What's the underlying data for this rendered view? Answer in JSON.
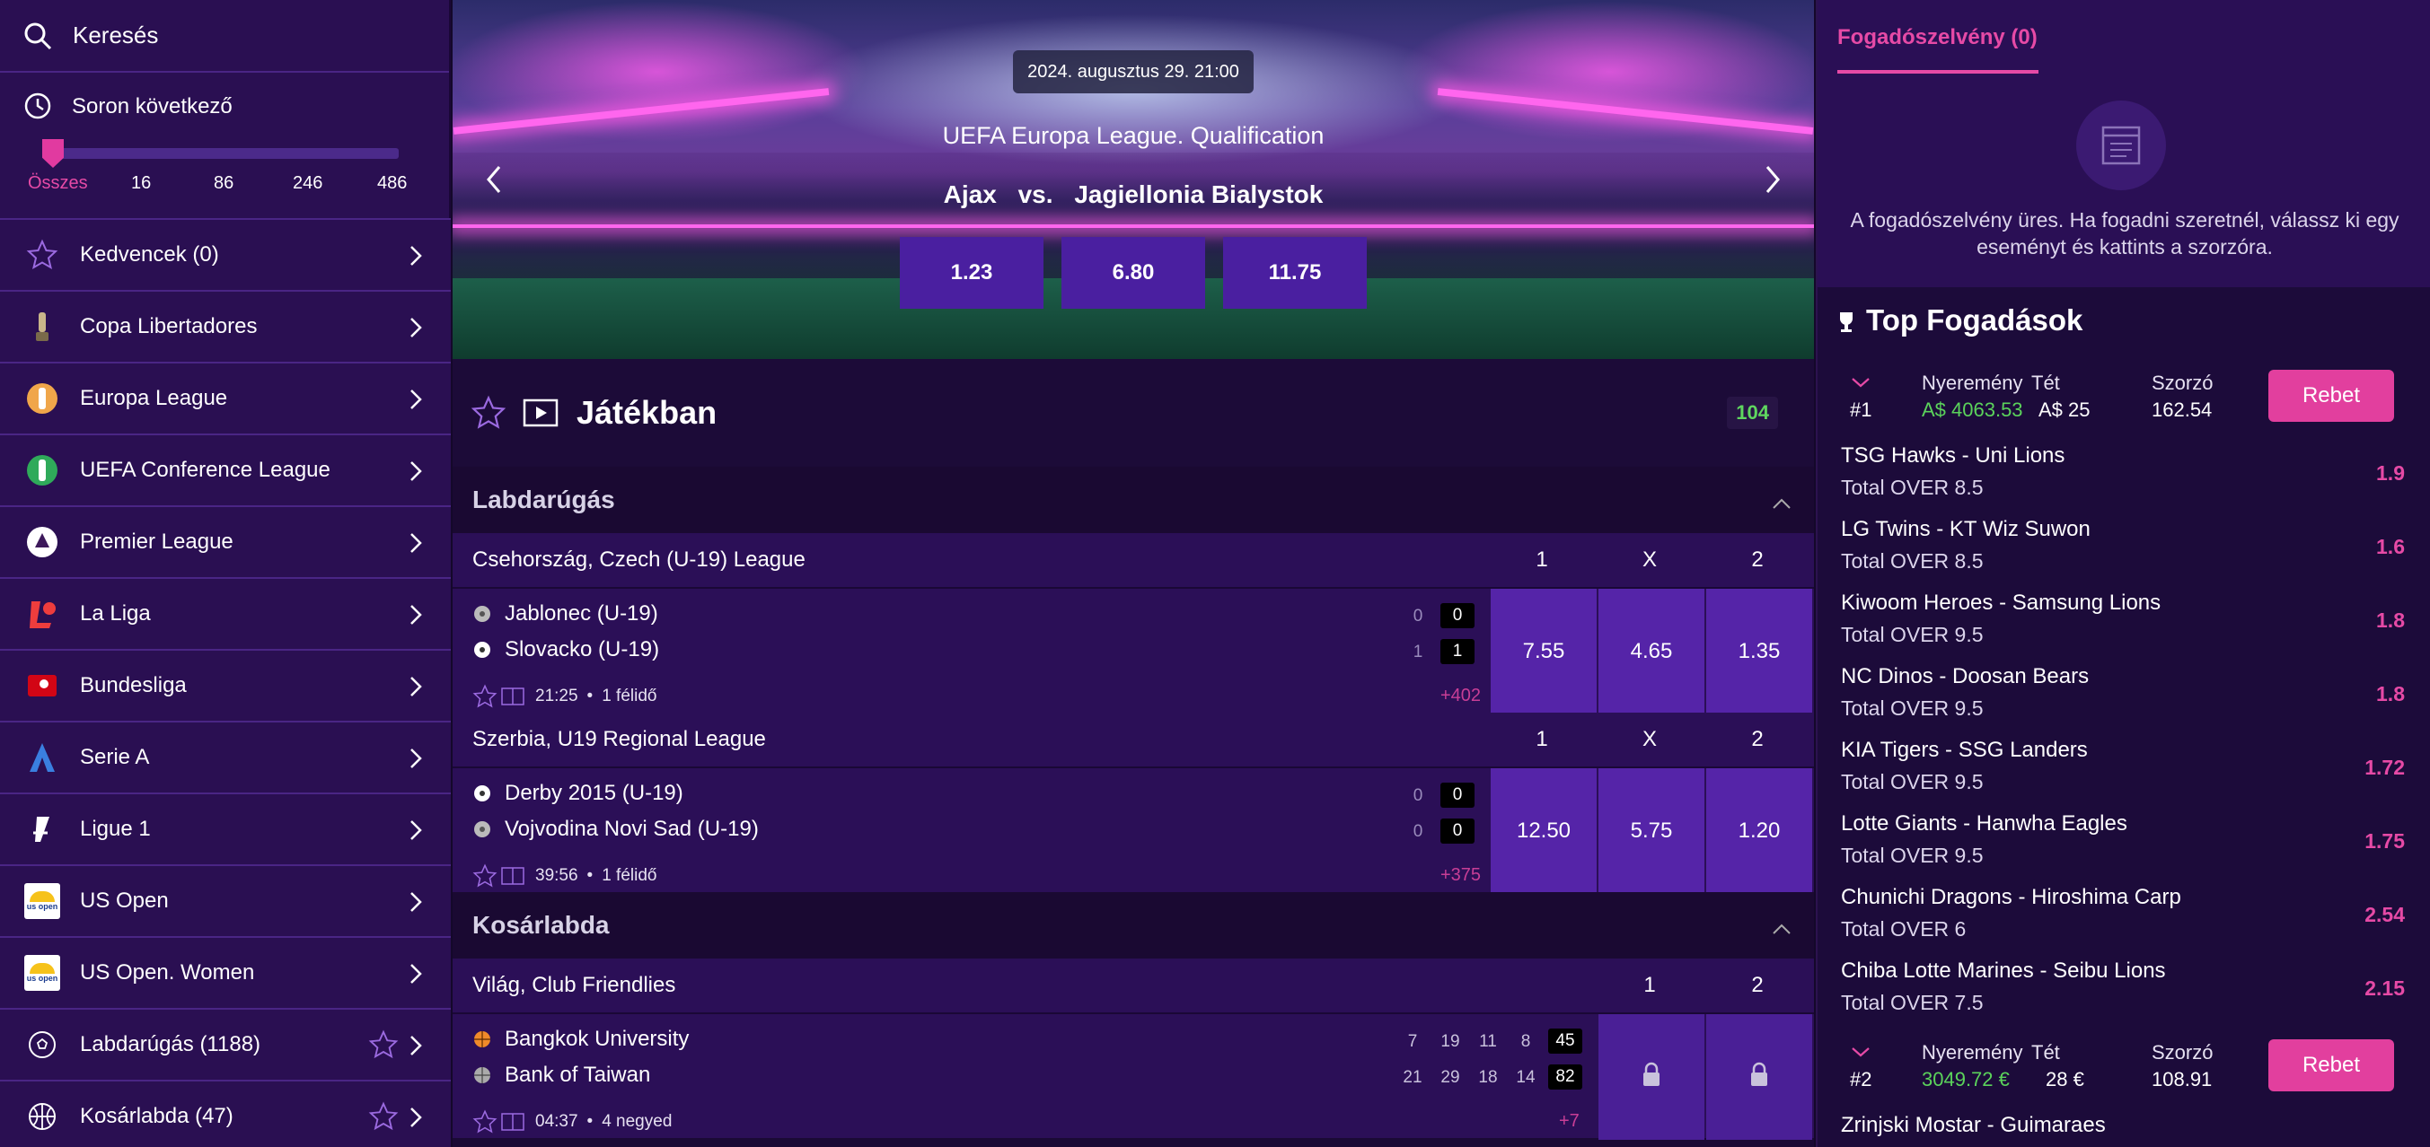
{
  "sidebar": {
    "search_label": "Keresés",
    "next_label": "Soron következő",
    "filter_labels": [
      "Összes",
      "16",
      "86",
      "246",
      "486"
    ],
    "items": [
      {
        "label": "Kedvencek (0)",
        "icon": "star-icon"
      },
      {
        "label": "Copa Libertadores",
        "icon": "copa-libertadores-logo"
      },
      {
        "label": "Europa League",
        "icon": "europa-league-logo"
      },
      {
        "label": "UEFA Conference League",
        "icon": "conference-league-logo"
      },
      {
        "label": "Premier League",
        "icon": "premier-league-logo"
      },
      {
        "label": "La Liga",
        "icon": "la-liga-logo"
      },
      {
        "label": "Bundesliga",
        "icon": "bundesliga-logo"
      },
      {
        "label": "Serie A",
        "icon": "serie-a-logo"
      },
      {
        "label": "Ligue 1",
        "icon": "ligue-1-logo"
      },
      {
        "label": "US Open",
        "icon": "us-open-logo"
      },
      {
        "label": "US Open. Women",
        "icon": "us-open-logo"
      },
      {
        "label": "Labdarúgás (1188)",
        "icon": "soccer-ball-icon"
      },
      {
        "label": "Kosárlabda (47)",
        "icon": "basketball-icon"
      }
    ],
    "us_open_text": "us open"
  },
  "hero": {
    "date": "2024. augusztus 29. 21:00",
    "competition": "UEFA Europa League. Qualification",
    "home": "Ajax",
    "vs": "vs.",
    "away": "Jagiellonia Bialystok",
    "odds": [
      "1.23",
      "6.80",
      "11.75"
    ]
  },
  "live": {
    "title": "Játékban",
    "count": "104"
  },
  "football": {
    "title": "Labdarúgás",
    "leagues": [
      {
        "name": "Csehország, Czech (U-19) League",
        "cols": [
          "1",
          "X",
          "2"
        ],
        "match": {
          "home": "Jablonec (U-19)",
          "away": "Slovacko (U-19)",
          "home_small": "0",
          "home_score": "0",
          "away_small": "1",
          "away_score": "1",
          "time": "21:25",
          "period": "1 félidő",
          "more": "+402",
          "odds": [
            "7.55",
            "4.65",
            "1.35"
          ]
        }
      },
      {
        "name": "Szerbia, U19 Regional League",
        "cols": [
          "1",
          "X",
          "2"
        ],
        "match": {
          "home": "Derby 2015 (U-19)",
          "away": "Vojvodina Novi Sad (U-19)",
          "home_small": "0",
          "home_score": "0",
          "away_small": "0",
          "away_score": "0",
          "time": "39:56",
          "period": "1 félidő",
          "more": "+375",
          "odds": [
            "12.50",
            "5.75",
            "1.20"
          ]
        }
      }
    ]
  },
  "basketball": {
    "title": "Kosárlabda",
    "league": {
      "name": "Világ, Club Friendlies",
      "cols": [
        "1",
        "2"
      ],
      "match": {
        "home": "Bangkok University",
        "away": "Bank of Taiwan",
        "home_quarters": [
          "7",
          "19",
          "11",
          "8"
        ],
        "home_total": "45",
        "away_quarters": [
          "21",
          "29",
          "18",
          "14"
        ],
        "away_total": "82",
        "time": "04:37",
        "period": "4 negyed",
        "more": "+7"
      }
    }
  },
  "betslip": {
    "tab": "Fogadószelvény (0)",
    "empty_text": "A fogadószelvény üres. Ha fogadni szeretnél, válassz ki egy eseményt és kattints a szorzóra."
  },
  "top_bets": {
    "title": "Top Fogadások",
    "win_label": "Nyeremény",
    "stake_label": "Tét",
    "odds_label": "Szorzó",
    "rebet_label": "Rebet",
    "slips": [
      {
        "rank": "#1",
        "win": "A$ 4063.53",
        "stake": "A$ 25",
        "odds": "162.54",
        "bets": [
          {
            "match": "TSG Hawks - Uni Lions",
            "selection": "Total OVER 8.5",
            "odd": "1.9"
          },
          {
            "match": "LG Twins - KT Wiz Suwon",
            "selection": "Total OVER 8.5",
            "odd": "1.6"
          },
          {
            "match": "Kiwoom Heroes - Samsung Lions",
            "selection": "Total OVER 9.5",
            "odd": "1.8"
          },
          {
            "match": "NC Dinos - Doosan Bears",
            "selection": "Total OVER 9.5",
            "odd": "1.8"
          },
          {
            "match": "KIA Tigers - SSG Landers",
            "selection": "Total OVER 9.5",
            "odd": "1.72"
          },
          {
            "match": "Lotte Giants - Hanwha Eagles",
            "selection": "Total OVER 9.5",
            "odd": "1.75"
          },
          {
            "match": "Chunichi Dragons - Hiroshima Carp",
            "selection": "Total OVER 6",
            "odd": "2.54"
          },
          {
            "match": "Chiba Lotte Marines - Seibu Lions",
            "selection": "Total OVER 7.5",
            "odd": "2.15"
          }
        ]
      },
      {
        "rank": "#2",
        "win": "3049.72 €",
        "stake": "28 €",
        "odds": "108.91",
        "bets": [
          {
            "match": "Zrinjski Mostar - Guimaraes",
            "selection": "",
            "odd": ""
          }
        ]
      }
    ]
  },
  "colors": {
    "accent_pink": "#e23f9e",
    "win_green": "#5bd35b",
    "odds_purple": "#5524a8",
    "sidebar_bg": "#2a0f52"
  }
}
